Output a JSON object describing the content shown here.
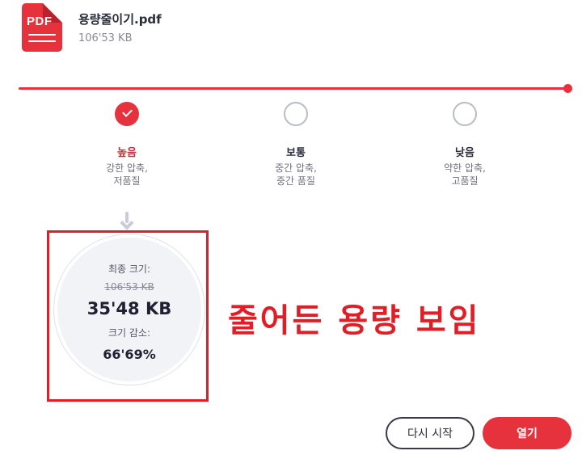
{
  "file": {
    "icon_label": "PDF",
    "name": "용량줄이기.pdf",
    "size": "106'53 KB"
  },
  "colors": {
    "accent": "#e5323c",
    "annotation": "#e01e26"
  },
  "options": [
    {
      "title": "높음",
      "desc1": "강한 압축,",
      "desc2": "저품질",
      "selected": true
    },
    {
      "title": "보통",
      "desc1": "중간 압축,",
      "desc2": "중간 품질",
      "selected": false
    },
    {
      "title": "낮음",
      "desc1": "약한 압축,",
      "desc2": "고품질",
      "selected": false
    }
  ],
  "result": {
    "final_size_label": "최종 크기:",
    "old_size": "106'53 KB",
    "new_size": "35'48 KB",
    "reduction_label": "크기 감소:",
    "reduction_pct": "66'69%"
  },
  "annotation": "줄어든 용량 보임",
  "buttons": {
    "restart": "다시 시작",
    "open": "열기"
  }
}
